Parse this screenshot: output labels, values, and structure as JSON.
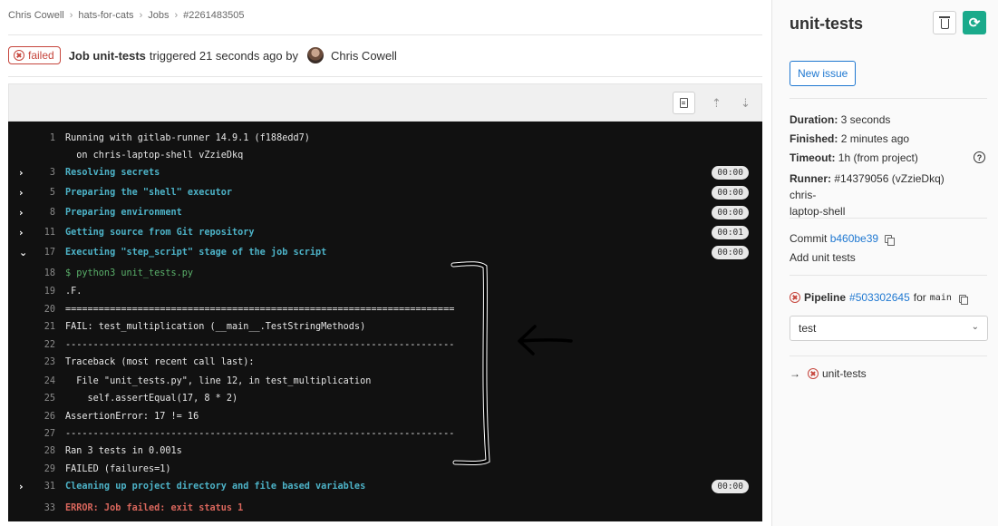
{
  "breadcrumb": [
    "Chris Cowell",
    "hats-for-cats",
    "Jobs",
    "#2261483505"
  ],
  "header": {
    "status": "failed",
    "job_label": "Job unit-tests",
    "triggered": "triggered 21 seconds ago by",
    "author": "Chris Cowell"
  },
  "toolbar": {
    "raw_icon": "document-icon",
    "scroll_top_icon": "scroll-top-icon",
    "scroll_bottom_icon": "scroll-bottom-icon"
  },
  "log": [
    {
      "num": "1",
      "text": "Running with gitlab-runner 14.9.1 (f188edd7)",
      "style": "plain"
    },
    {
      "num": "",
      "text": "  on chris-laptop-shell vZzieDkq",
      "style": "plain"
    },
    {
      "num": "3",
      "text": "Resolving secrets",
      "style": "cyan",
      "chevron": ">",
      "duration": "00:00"
    },
    {
      "num": "5",
      "text": "Preparing the \"shell\" executor",
      "style": "cyan",
      "chevron": ">",
      "duration": "00:00"
    },
    {
      "num": "8",
      "text": "Preparing environment",
      "style": "cyan",
      "chevron": ">",
      "duration": "00:00"
    },
    {
      "num": "11",
      "text": "Getting source from Git repository",
      "style": "cyan",
      "chevron": ">",
      "duration": "00:01"
    },
    {
      "num": "17",
      "text": "Executing \"step_script\" stage of the job script",
      "style": "cyan",
      "chevron": "v",
      "duration": "00:00"
    },
    {
      "num": "18",
      "text": "$ python3 unit_tests.py",
      "style": "green"
    },
    {
      "num": "19",
      "text": ".F.",
      "style": "plain"
    },
    {
      "num": "20",
      "text": "======================================================================",
      "style": "plain"
    },
    {
      "num": "21",
      "text": "FAIL: test_multiplication (__main__.TestStringMethods)",
      "style": "plain"
    },
    {
      "num": "22",
      "text": "----------------------------------------------------------------------",
      "style": "plain"
    },
    {
      "num": "23",
      "text": "Traceback (most recent call last):",
      "style": "plain"
    },
    {
      "num": "24",
      "text": "  File \"unit_tests.py\", line 12, in test_multiplication",
      "style": "plain"
    },
    {
      "num": "25",
      "text": "    self.assertEqual(17, 8 * 2)",
      "style": "plain"
    },
    {
      "num": "26",
      "text": "AssertionError: 17 != 16",
      "style": "plain"
    },
    {
      "num": "27",
      "text": "----------------------------------------------------------------------",
      "style": "plain"
    },
    {
      "num": "28",
      "text": "Ran 3 tests in 0.001s",
      "style": "plain"
    },
    {
      "num": "29",
      "text": "FAILED (failures=1)",
      "style": "plain"
    },
    {
      "num": "31",
      "text": "Cleaning up project directory and file based variables",
      "style": "cyan",
      "chevron": ">",
      "duration": "00:00"
    },
    {
      "num": "33",
      "text": "ERROR: Job failed: exit status 1",
      "style": "red"
    }
  ],
  "sidebar": {
    "title": "unit-tests",
    "new_issue": "New issue",
    "duration_label": "Duration:",
    "duration_value": "3 seconds",
    "finished_label": "Finished:",
    "finished_value": "2 minutes ago",
    "timeout_label": "Timeout:",
    "timeout_value": "1h (from project)",
    "runner_label": "Runner:",
    "runner_value": "#14379056 (vZzieDkq) chris-",
    "runner_value2": "laptop-shell",
    "commit_label": "Commit",
    "commit_sha": "b460be39",
    "commit_message": "Add unit tests",
    "pipeline_label": "Pipeline",
    "pipeline_id": "#503302645",
    "pipeline_for": "for",
    "pipeline_branch": "main",
    "stage_select": "test",
    "job_link": "unit-tests"
  },
  "colors": {
    "failed": "#c6463d",
    "link": "#1f78d1",
    "retry": "#1aaa8b",
    "log_bg": "#111111",
    "section": "#4db3c8"
  }
}
